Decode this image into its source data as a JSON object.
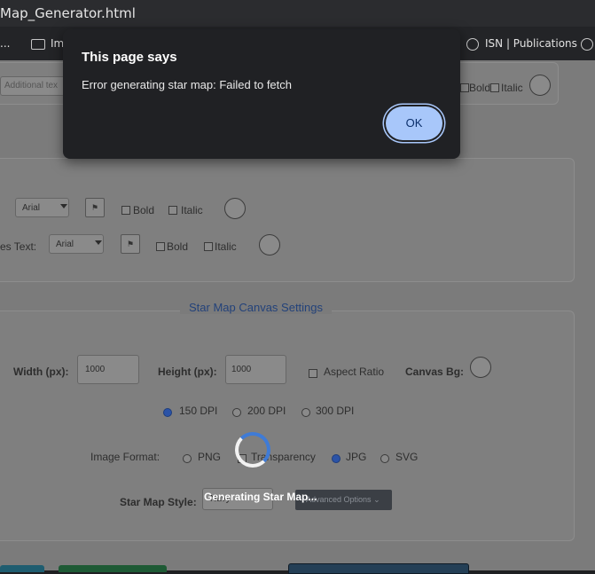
{
  "browser": {
    "tab_title": "Map_Generator.html",
    "bookmarks": [
      {
        "label": "..."
      },
      {
        "label": "Im"
      },
      {
        "label": "ISN | Publications"
      }
    ]
  },
  "dialog": {
    "title": "This page says",
    "message": "Error generating star map: Failed to fetch",
    "ok_label": "OK"
  },
  "top_form": {
    "additional_text_placeholder": "Additional tex",
    "bold_label": "Bold",
    "italic_label": "Italic"
  },
  "text_styles": {
    "row1": {
      "font": "Arial",
      "bold_label": "Bold",
      "italic_label": "Italic"
    },
    "row2": {
      "label": "es Text:",
      "font": "Arial",
      "bold_label": "Bold",
      "italic_label": "Italic"
    }
  },
  "canvas_settings": {
    "legend": "Star Map Canvas Settings",
    "width_label": "Width (px):",
    "width_value": "1000",
    "height_label": "Height (px):",
    "height_value": "1000",
    "aspect_label": "Aspect Ratio",
    "canvas_bg_label": "Canvas Bg:",
    "dpi": [
      {
        "label": "150 DPI",
        "selected": true
      },
      {
        "label": "200 DPI",
        "selected": false
      },
      {
        "label": "300 DPI",
        "selected": false
      }
    ],
    "format_label": "Image Format:",
    "formats": [
      {
        "label": "PNG",
        "selected": false
      },
      {
        "label": "Transparency",
        "selected": false
      },
      {
        "label": "JPG",
        "selected": true
      },
      {
        "label": "SVG",
        "selected": false
      }
    ],
    "style_label": "Star Map Style:",
    "style_value": "Navy",
    "advanced_label": "Advanced Options"
  },
  "loading": {
    "text": "Generating Star Map..."
  },
  "colors": {
    "dialog_bg": "#202124",
    "ok_bg": "#a8c7fa",
    "legend": "#23427a",
    "spinner_accent": "#3f7bd6"
  }
}
